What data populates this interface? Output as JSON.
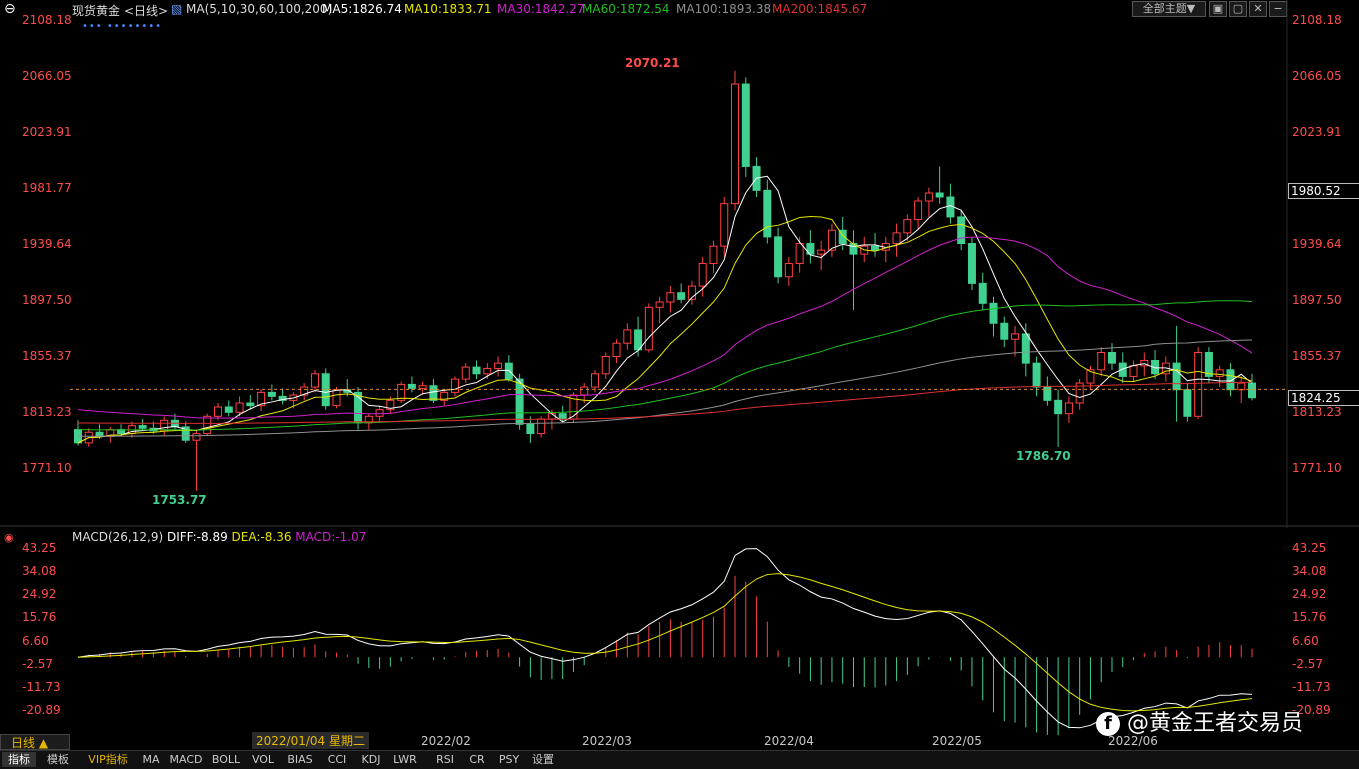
{
  "header": {
    "instrument": "现货黄金",
    "period": "<日线>",
    "ma_label": "MA(5,10,30,60,100,200)",
    "ma5": "MA5:1826.74",
    "ma10": "MA10:1833.71",
    "ma30": "MA30:1842.27",
    "ma60": "MA60:1872.54",
    "ma100": "MA100:1893.38",
    "ma200": "MA200:1845.67",
    "theme_button": "全部主题▼",
    "dots": "••• ••••••••"
  },
  "colors": {
    "ma5": "#ffffff",
    "ma10": "#e6e600",
    "ma30": "#d020d0",
    "ma60": "#20c020",
    "ma100": "#909090",
    "ma200": "#e03030",
    "up": "#ff4040",
    "down": "#40d090",
    "price_label": "#ff4d4d"
  },
  "price_axis": {
    "labels": [
      "2108.18",
      "2066.05",
      "2023.91",
      "1981.77",
      "1939.64",
      "1897.50",
      "1855.37",
      "1813.23",
      "1771.10"
    ],
    "current_price": "1824.25",
    "highlight_price": "1980.52",
    "annot_high": "2070.21",
    "annot_low1": "1753.77",
    "annot_low2": "1786.70"
  },
  "macd": {
    "title": "MACD(26,12,9)",
    "diff": "DIFF:-8.89",
    "dea": "DEA:-8.36",
    "macd_val": "MACD:-1.07",
    "axis_labels": [
      "43.25",
      "34.08",
      "24.92",
      "15.76",
      "6.60",
      "-2.57",
      "-11.73",
      "-20.89"
    ]
  },
  "dates": {
    "cursor_label": "2022/01/04 星期二",
    "ticks": [
      "2022/02",
      "2022/03",
      "2022/04",
      "2022/05",
      "2022/06"
    ]
  },
  "watermark": "@黄金王者交易员",
  "footer": {
    "period_button": "日线 ▲",
    "tabs": [
      "指标",
      "模板",
      "VIP指标",
      "MA",
      "MACD",
      "BOLL",
      "VOL",
      "BIAS",
      "CCI",
      "KDJ",
      "LWR",
      "RSI",
      "CR",
      "PSY",
      "设置"
    ]
  },
  "chart_data": {
    "type": "candlestick",
    "title": "现货黄金 日线",
    "y_range": [
      1750,
      2108.18
    ],
    "candles_ohlc": [
      [
        1800,
        1807,
        1788,
        1790
      ],
      [
        1790,
        1801,
        1787,
        1798
      ],
      [
        1798,
        1804,
        1793,
        1795
      ],
      [
        1795,
        1802,
        1790,
        1800
      ],
      [
        1800,
        1804,
        1795,
        1797
      ],
      [
        1797,
        1806,
        1794,
        1803
      ],
      [
        1803,
        1808,
        1799,
        1801
      ],
      [
        1801,
        1806,
        1797,
        1799
      ],
      [
        1799,
        1810,
        1795,
        1807
      ],
      [
        1807,
        1812,
        1800,
        1802
      ],
      [
        1802,
        1806,
        1790,
        1792
      ],
      [
        1792,
        1800,
        1754,
        1797
      ],
      [
        1797,
        1812,
        1795,
        1810
      ],
      [
        1810,
        1820,
        1807,
        1817
      ],
      [
        1817,
        1822,
        1810,
        1813
      ],
      [
        1813,
        1825,
        1810,
        1820
      ],
      [
        1820,
        1826,
        1815,
        1818
      ],
      [
        1818,
        1830,
        1814,
        1828
      ],
      [
        1828,
        1834,
        1822,
        1825
      ],
      [
        1825,
        1831,
        1819,
        1822
      ],
      [
        1822,
        1828,
        1816,
        1826
      ],
      [
        1826,
        1835,
        1822,
        1832
      ],
      [
        1832,
        1845,
        1828,
        1842
      ],
      [
        1842,
        1846,
        1815,
        1818
      ],
      [
        1818,
        1832,
        1816,
        1830
      ],
      [
        1830,
        1838,
        1825,
        1828
      ],
      [
        1828,
        1832,
        1800,
        1805
      ],
      [
        1805,
        1812,
        1800,
        1810
      ],
      [
        1810,
        1818,
        1806,
        1815
      ],
      [
        1815,
        1825,
        1812,
        1822
      ],
      [
        1822,
        1836,
        1820,
        1834
      ],
      [
        1834,
        1840,
        1828,
        1831
      ],
      [
        1831,
        1836,
        1826,
        1833
      ],
      [
        1833,
        1838,
        1820,
        1822
      ],
      [
        1822,
        1830,
        1818,
        1828
      ],
      [
        1828,
        1840,
        1825,
        1838
      ],
      [
        1838,
        1850,
        1835,
        1847
      ],
      [
        1847,
        1852,
        1838,
        1842
      ],
      [
        1842,
        1850,
        1838,
        1846
      ],
      [
        1846,
        1855,
        1840,
        1850
      ],
      [
        1850,
        1856,
        1836,
        1838
      ],
      [
        1838,
        1842,
        1800,
        1804
      ],
      [
        1804,
        1810,
        1790,
        1797
      ],
      [
        1797,
        1810,
        1794,
        1808
      ],
      [
        1808,
        1815,
        1800,
        1812
      ],
      [
        1812,
        1818,
        1806,
        1808
      ],
      [
        1808,
        1828,
        1805,
        1826
      ],
      [
        1826,
        1835,
        1820,
        1832
      ],
      [
        1832,
        1845,
        1828,
        1842
      ],
      [
        1842,
        1858,
        1838,
        1855
      ],
      [
        1855,
        1868,
        1850,
        1865
      ],
      [
        1865,
        1880,
        1860,
        1875
      ],
      [
        1875,
        1885,
        1855,
        1860
      ],
      [
        1860,
        1895,
        1858,
        1892
      ],
      [
        1892,
        1900,
        1880,
        1896
      ],
      [
        1896,
        1908,
        1888,
        1903
      ],
      [
        1903,
        1910,
        1895,
        1898
      ],
      [
        1898,
        1912,
        1894,
        1908
      ],
      [
        1908,
        1930,
        1900,
        1925
      ],
      [
        1925,
        1942,
        1918,
        1938
      ],
      [
        1938,
        1975,
        1930,
        1970
      ],
      [
        1970,
        2070,
        1965,
        2060
      ],
      [
        2060,
        2065,
        1990,
        1998
      ],
      [
        1998,
        2005,
        1975,
        1980
      ],
      [
        1980,
        1988,
        1940,
        1945
      ],
      [
        1945,
        1952,
        1910,
        1915
      ],
      [
        1915,
        1930,
        1908,
        1925
      ],
      [
        1925,
        1945,
        1918,
        1940
      ],
      [
        1940,
        1950,
        1925,
        1932
      ],
      [
        1932,
        1942,
        1920,
        1935
      ],
      [
        1935,
        1955,
        1930,
        1950
      ],
      [
        1950,
        1960,
        1935,
        1940
      ],
      [
        1940,
        1950,
        1890,
        1932
      ],
      [
        1932,
        1945,
        1926,
        1938
      ],
      [
        1938,
        1948,
        1930,
        1935
      ],
      [
        1935,
        1945,
        1926,
        1940
      ],
      [
        1940,
        1955,
        1930,
        1948
      ],
      [
        1948,
        1962,
        1942,
        1958
      ],
      [
        1958,
        1975,
        1950,
        1972
      ],
      [
        1972,
        1982,
        1960,
        1978
      ],
      [
        1978,
        1998,
        1970,
        1975
      ],
      [
        1975,
        1985,
        1955,
        1960
      ],
      [
        1960,
        1965,
        1935,
        1940
      ],
      [
        1940,
        1945,
        1905,
        1910
      ],
      [
        1910,
        1918,
        1890,
        1895
      ],
      [
        1895,
        1900,
        1870,
        1880
      ],
      [
        1880,
        1885,
        1862,
        1868
      ],
      [
        1868,
        1878,
        1855,
        1872
      ],
      [
        1872,
        1880,
        1840,
        1850
      ],
      [
        1850,
        1855,
        1825,
        1832
      ],
      [
        1832,
        1840,
        1818,
        1822
      ],
      [
        1822,
        1830,
        1787,
        1812
      ],
      [
        1812,
        1825,
        1805,
        1820
      ],
      [
        1820,
        1838,
        1815,
        1835
      ],
      [
        1835,
        1848,
        1830,
        1845
      ],
      [
        1845,
        1862,
        1840,
        1858
      ],
      [
        1858,
        1865,
        1845,
        1850
      ],
      [
        1850,
        1858,
        1835,
        1840
      ],
      [
        1840,
        1852,
        1836,
        1848
      ],
      [
        1848,
        1858,
        1840,
        1852
      ],
      [
        1852,
        1860,
        1838,
        1842
      ],
      [
        1842,
        1855,
        1836,
        1850
      ],
      [
        1850,
        1878,
        1806,
        1830
      ],
      [
        1830,
        1835,
        1806,
        1810
      ],
      [
        1810,
        1862,
        1808,
        1858
      ],
      [
        1858,
        1862,
        1835,
        1840
      ],
      [
        1840,
        1848,
        1832,
        1845
      ],
      [
        1845,
        1850,
        1825,
        1830
      ],
      [
        1830,
        1840,
        1820,
        1835
      ],
      [
        1835,
        1842,
        1822,
        1824
      ]
    ],
    "annotations": [
      {
        "label": "2070.21",
        "value": 2070.21
      },
      {
        "label": "1753.77",
        "value": 1753.77
      },
      {
        "label": "1786.70",
        "value": 1786.7
      }
    ],
    "ma_last_values": {
      "MA5": 1826.74,
      "MA10": 1833.71,
      "MA30": 1842.27,
      "MA60": 1872.54,
      "MA100": 1893.38,
      "MA200": 1845.67
    },
    "macd_range": [
      -20.89,
      43.25
    ],
    "macd_last": {
      "DIFF": -8.89,
      "DEA": -8.36,
      "MACD": -1.07
    }
  }
}
